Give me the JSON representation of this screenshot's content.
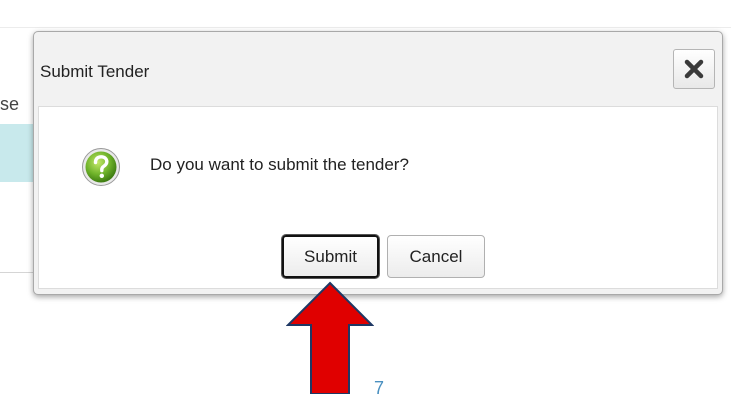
{
  "background": {
    "partial_label": "se",
    "number": "7"
  },
  "dialog": {
    "title": "Submit Tender",
    "close_glyph": "✖",
    "message": "Do you want to submit the tender?",
    "icon": "question-icon",
    "buttons": {
      "submit_label": "Submit",
      "cancel_label": "Cancel"
    }
  },
  "colors": {
    "dialog_header_bg": "#f2f2f2",
    "icon_green": "#6fb32a",
    "highlight_band": "#c8e9ec",
    "arrow_fill": "#e00000",
    "arrow_stroke": "#1f3864"
  }
}
